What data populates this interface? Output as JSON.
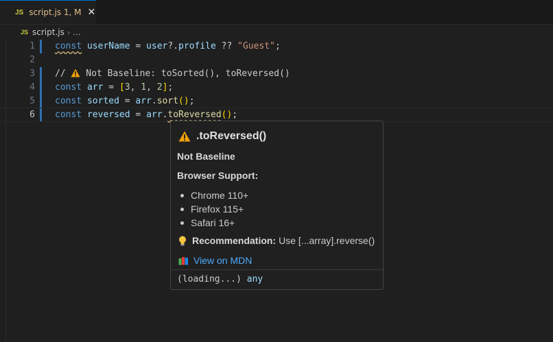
{
  "tab": {
    "badge": "JS",
    "title": "script.js 1, M",
    "close": "✕"
  },
  "breadcrumb": {
    "badge": "JS",
    "file": "script.js",
    "sep": "›",
    "more": "..."
  },
  "editor": {
    "line_numbers": [
      "1",
      "2",
      "3",
      "4",
      "5",
      "6"
    ],
    "current_line": 6,
    "line1": {
      "kw": "const",
      "name": "userName",
      "eq": " = ",
      "obj": "user",
      "op": "?.",
      "prop": "profile",
      "nullish": " ?? ",
      "str": "\"Guest\"",
      "end": ";"
    },
    "line3": {
      "prefix": "// ",
      "text": " Not Baseline: toSorted(), toReversed()"
    },
    "line4": {
      "kw": "const",
      "name": "arr",
      "eq": " = ",
      "open": "[",
      "n1": "3",
      "c1": ", ",
      "n2": "1",
      "c2": ", ",
      "n3": "2",
      "close": "]",
      "end": ";"
    },
    "line5": {
      "kw": "const",
      "name": "sorted",
      "eq": " = ",
      "obj": "arr",
      "dot": ".",
      "fn": "sort",
      "parens": "()",
      "end": ";"
    },
    "line6": {
      "kw": "const",
      "name": "reversed",
      "eq": " = ",
      "obj": "arr",
      "dot": ".",
      "fn": "toReversed",
      "parens": "()",
      "end": ";"
    }
  },
  "hover": {
    "title": ".toReversed()",
    "status": "Not Baseline",
    "support_heading": "Browser Support:",
    "browsers": [
      "Chrome 110+",
      "Firefox 115+",
      "Safari 16+"
    ],
    "recommendation_label": "Recommendation:",
    "recommendation_text": "Use [...array].reverse()",
    "mdn_link": "View on MDN",
    "footer_loading": "(loading...)",
    "footer_type": "any",
    "icons": {
      "warning": "warning-icon",
      "bulb": "lightbulb-icon",
      "books": "books-icon"
    },
    "colors": {
      "warning": "#f0a30a",
      "link": "#4daafc"
    }
  }
}
